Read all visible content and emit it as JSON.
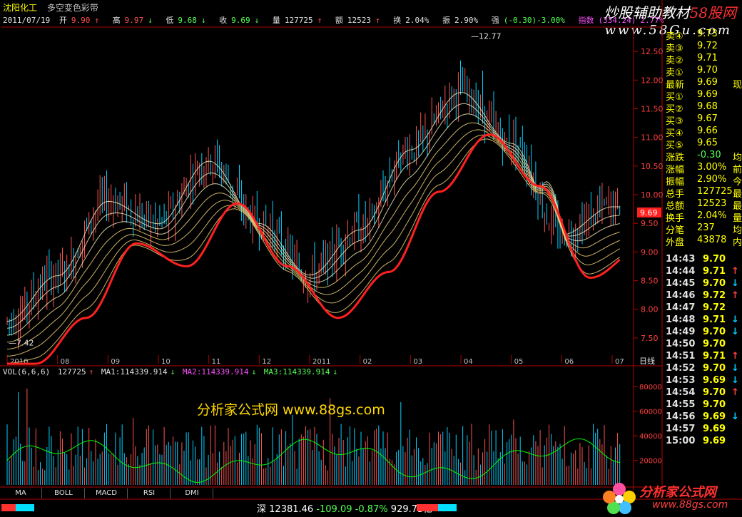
{
  "header": {
    "stock_name": "沈阳化工",
    "formula_name": "多空变色彩带",
    "date": "2011/07/19",
    "open_label": "开",
    "open": "9.90",
    "high_label": "高",
    "high": "9.97",
    "low_label": "低",
    "low": "9.68",
    "close_label": "收",
    "close": "9.69",
    "volume_label": "量",
    "volume": "127725",
    "amount_label": "额",
    "amount": "12523",
    "turnover_label": "换",
    "turnover": "2.04%",
    "amplitude_label": "振",
    "amplitude": "2.90%",
    "strength_label": "强",
    "strength": "(-0.30)-3.00%",
    "index_label": "指数",
    "index_value": "(334.24)",
    "index_pct": "2.77%"
  },
  "branding": {
    "top_title_a": "炒股辅助教材",
    "top_title_b": "58股网",
    "top_url": "www.58Gu.com",
    "watermark": "分析家公式网 www.88gs.com",
    "logo_name": "分析家公式网",
    "logo_url": "www.88gs.com"
  },
  "chart_annotations": {
    "max_label": "12.77",
    "min_label": "7.42",
    "last_price_tag": "9.69",
    "period_label": "日线"
  },
  "quote_panel": {
    "rows": [
      {
        "label": "卖④",
        "value": "9.73"
      },
      {
        "label": "卖③",
        "value": "9.72"
      },
      {
        "label": "卖②",
        "value": "9.71"
      },
      {
        "label": "卖①",
        "value": "9.70"
      },
      {
        "label": "最新",
        "value": "9.69",
        "extra": "现"
      },
      {
        "label": "买①",
        "value": "9.69"
      },
      {
        "label": "买②",
        "value": "9.68"
      },
      {
        "label": "买③",
        "value": "9.67"
      },
      {
        "label": "买④",
        "value": "9.66"
      },
      {
        "label": "买⑤",
        "value": "9.65"
      },
      {
        "label": "涨跌",
        "value": "-0.30",
        "extra": "均"
      },
      {
        "label": "涨幅",
        "value": "3.00%",
        "extra": "前"
      },
      {
        "label": "振幅",
        "value": "2.90%",
        "extra": "今"
      },
      {
        "label": "总手",
        "value": "127725",
        "extra": "最"
      },
      {
        "label": "总额",
        "value": "12523",
        "extra": "最"
      },
      {
        "label": "换手",
        "value": "2.04%",
        "extra": "量"
      },
      {
        "label": "分笔",
        "value": "237",
        "extra": "均"
      },
      {
        "label": "外盘",
        "value": "43878",
        "extra": "内"
      }
    ],
    "ticks": [
      {
        "time": "14:43",
        "price": "9.70",
        "dir": ""
      },
      {
        "time": "14:44",
        "price": "9.71",
        "dir": "up"
      },
      {
        "time": "14:45",
        "price": "9.70",
        "dir": "down"
      },
      {
        "time": "14:46",
        "price": "9.72",
        "dir": "up"
      },
      {
        "time": "14:47",
        "price": "9.72",
        "dir": ""
      },
      {
        "time": "14:48",
        "price": "9.71",
        "dir": "down"
      },
      {
        "time": "14:49",
        "price": "9.70",
        "dir": "down"
      },
      {
        "time": "14:50",
        "price": "9.70",
        "dir": ""
      },
      {
        "time": "14:51",
        "price": "9.71",
        "dir": "up"
      },
      {
        "time": "14:52",
        "price": "9.70",
        "dir": "down"
      },
      {
        "time": "14:53",
        "price": "9.69",
        "dir": "down"
      },
      {
        "time": "14:54",
        "price": "9.70",
        "dir": "up"
      },
      {
        "time": "14:55",
        "price": "9.70",
        "dir": ""
      },
      {
        "time": "14:56",
        "price": "9.69",
        "dir": "down"
      },
      {
        "time": "14:57",
        "price": "9.69",
        "dir": ""
      },
      {
        "time": "15:00",
        "price": "9.69",
        "dir": ""
      }
    ]
  },
  "volume_header": {
    "label": "VOL(6,6,6)",
    "value": "127725",
    "ma1": "MA1:114339.914",
    "ma2": "MA2:114339.914",
    "ma3": "MA3:114339.914"
  },
  "tabs": [
    "MA",
    "BOLL",
    "MACD",
    "RSI",
    "DMI"
  ],
  "status_bar": {
    "market": "深",
    "index": "12381.46",
    "change": "-109.09",
    "pct": "-0.87%",
    "amount": "929.73亿"
  },
  "icons": {
    "up_arrow": "↑",
    "down_arrow": "↓"
  },
  "colors": {
    "up": "#ff5050",
    "down": "#54ff54",
    "frame": "#b00000",
    "ribbon_bottom": "#ff2020",
    "ribbon_green": "#30ff30",
    "ribbon_blue": "#2040ff"
  },
  "chart_data": [
    {
      "type": "candlestick",
      "title": "沈阳化工 多空变色彩带",
      "x_ticks": [
        "2010",
        "08",
        "09",
        "10",
        "11",
        "12",
        "2011",
        "02",
        "03",
        "04",
        "05",
        "06",
        "07"
      ],
      "y_ticks": [
        7.5,
        8.0,
        8.5,
        9.0,
        9.5,
        10.0,
        10.5,
        11.0,
        11.5,
        12.0,
        12.5
      ],
      "ylim": [
        7.2,
        12.9
      ],
      "period": "daily",
      "max": 12.77,
      "min": 7.42,
      "last": 9.69,
      "trend_anchors": [
        {
          "x": "2010",
          "y": 7.8
        },
        {
          "x": "08",
          "y": 8.6
        },
        {
          "x": "09",
          "y": 9.9
        },
        {
          "x": "10",
          "y": 9.5
        },
        {
          "x": "11",
          "y": 10.6
        },
        {
          "x": "12",
          "y": 9.5
        },
        {
          "x": "2011",
          "y": 8.6
        },
        {
          "x": "02",
          "y": 9.4
        },
        {
          "x": "03",
          "y": 10.8
        },
        {
          "x": "04",
          "y": 11.8
        },
        {
          "x": "05",
          "y": 10.9
        },
        {
          "x": "06",
          "y": 9.3
        },
        {
          "x": "07",
          "y": 9.8
        }
      ]
    },
    {
      "type": "bar",
      "title": "VOL(6,6,6)",
      "y_ticks": [
        20000,
        40000,
        60000,
        80000
      ],
      "ylim": [
        0,
        90000
      ],
      "last_volume": 127725,
      "ma": 114339.914
    }
  ]
}
